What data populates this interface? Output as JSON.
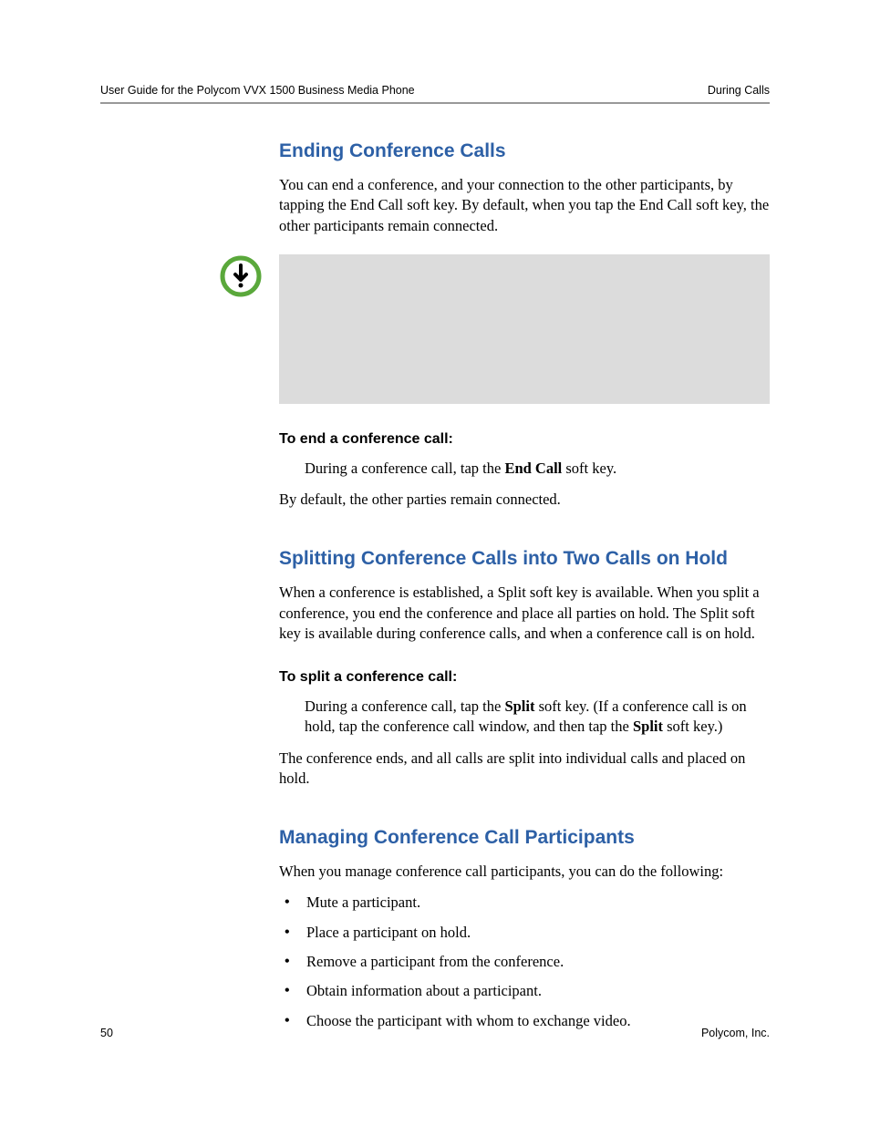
{
  "header": {
    "left": "User Guide for the Polycom VVX 1500 Business Media Phone",
    "right": "During Calls"
  },
  "section1": {
    "title": "Ending Conference Calls",
    "intro": "You can end a conference, and your connection to the other participants, by tapping the End Call soft key. By default, when you tap the End Call soft key, the other participants remain connected.",
    "subhead": "To end a conference call:",
    "step_a": "During a conference call, tap the ",
    "step_bold": "End Call",
    "step_b": " soft key.",
    "note": "By default, the other parties remain connected."
  },
  "section2": {
    "title": "Splitting Conference Calls into Two Calls on Hold",
    "intro": "When a conference is established, a Split soft key is available. When you split a conference, you end the conference and place all parties on hold. The Split soft key is available during conference calls, and when a conference call is on hold.",
    "subhead": "To split a conference call:",
    "step_a": "During a conference call, tap the ",
    "step_bold1": "Split",
    "step_b": " soft key. (If a conference call is on hold, tap the conference call window, and then tap the ",
    "step_bold2": "Split",
    "step_c": " soft key.)",
    "result": "The conference ends, and all calls are split into individual calls and placed on hold."
  },
  "section3": {
    "title": "Managing Conference Call Participants",
    "intro": "When you manage conference call participants, you can do the following:",
    "bullets": [
      "Mute a participant.",
      "Place a participant on hold.",
      "Remove a participant from the conference.",
      "Obtain information about a participant.",
      "Choose the participant with whom to exchange video."
    ]
  },
  "footer": {
    "page": "50",
    "company": "Polycom, Inc."
  }
}
